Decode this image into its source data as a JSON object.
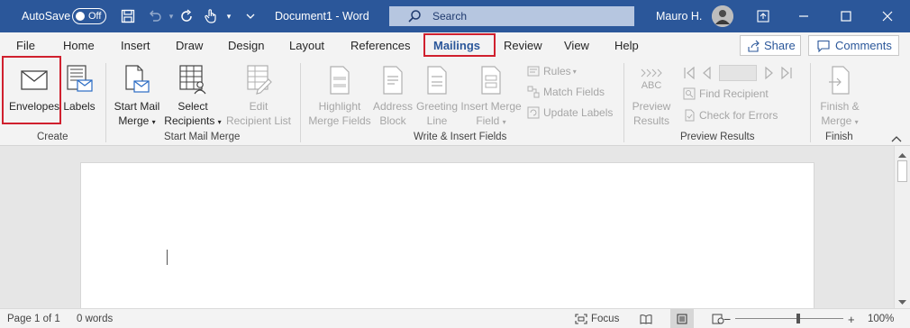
{
  "titlebar": {
    "autosave_label": "AutoSave",
    "autosave_state": "Off",
    "doc_title": "Document1 - Word",
    "search_placeholder": "Search",
    "user_name": "Mauro H.",
    "bg_color": "#2b579a"
  },
  "tabs": [
    {
      "label": "File"
    },
    {
      "label": "Home"
    },
    {
      "label": "Insert"
    },
    {
      "label": "Draw"
    },
    {
      "label": "Design"
    },
    {
      "label": "Layout"
    },
    {
      "label": "References"
    },
    {
      "label": "Mailings",
      "active": true
    },
    {
      "label": "Review"
    },
    {
      "label": "View"
    },
    {
      "label": "Help"
    }
  ],
  "share_label": "Share",
  "comments_label": "Comments",
  "ribbon": {
    "create": {
      "label": "Create",
      "envelopes": "Envelopes",
      "labels": "Labels"
    },
    "start_mail_merge": {
      "label": "Start Mail Merge",
      "start_mail_merge_l1": "Start Mail",
      "start_mail_merge_l2": "Merge",
      "select_recipients_l1": "Select",
      "select_recipients_l2": "Recipients",
      "edit_recipient_list_l1": "Edit",
      "edit_recipient_list_l2": "Recipient List"
    },
    "write_insert": {
      "label": "Write & Insert Fields",
      "highlight_l1": "Highlight",
      "highlight_l2": "Merge Fields",
      "address_l1": "Address",
      "address_l2": "Block",
      "greeting_l1": "Greeting",
      "greeting_l2": "Line",
      "insert_merge_l1": "Insert Merge",
      "insert_merge_l2": "Field",
      "rules": "Rules",
      "match_fields": "Match Fields",
      "update_labels": "Update Labels"
    },
    "preview": {
      "label": "Preview Results",
      "abc": "ABC",
      "preview_l1": "Preview",
      "preview_l2": "Results",
      "find_recipient": "Find Recipient",
      "check_errors": "Check for Errors"
    },
    "finish": {
      "label": "Finish",
      "finish_l1": "Finish &",
      "finish_l2": "Merge"
    }
  },
  "status": {
    "page": "Page 1 of 1",
    "words": "0 words",
    "focus": "Focus",
    "zoom_minus": "−",
    "zoom_plus": "+",
    "zoom": "100%"
  },
  "colors": {
    "accent": "#2b579a",
    "highlight_red": "#d0202e"
  }
}
